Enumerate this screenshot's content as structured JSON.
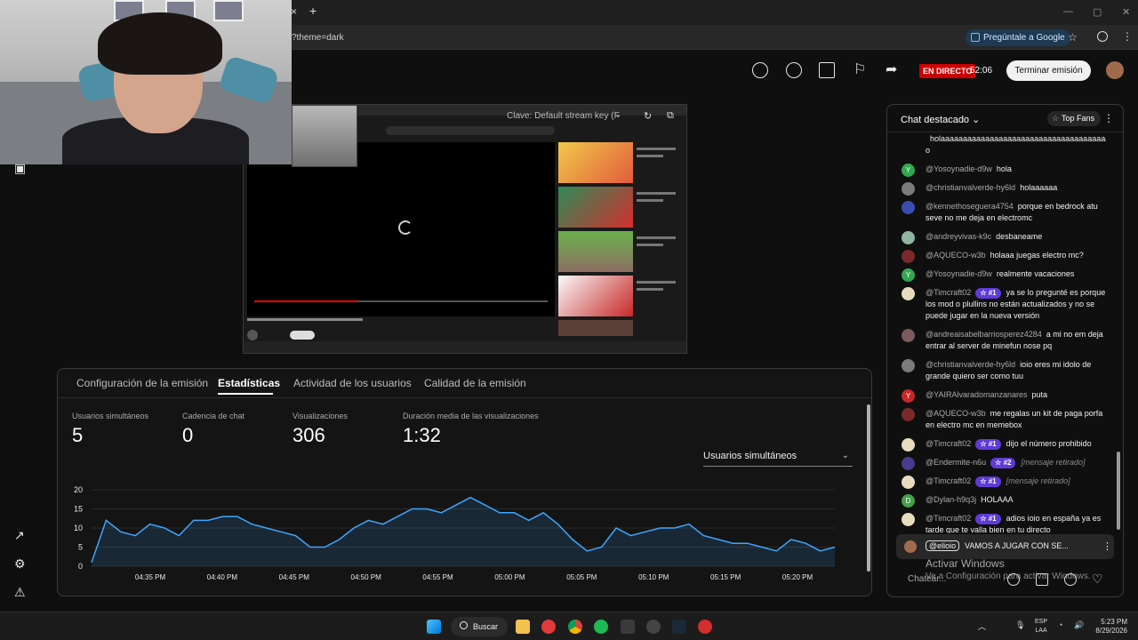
{
  "browser": {
    "url_fragment": "?theme=dark",
    "ask_google": "Pregúntale a Google"
  },
  "header": {
    "live_badge": "EN DIRECTO",
    "live_time": "52:06",
    "end_button": "Terminar emisión"
  },
  "preview": {
    "stream_key": "Clave: Default stream key (F"
  },
  "stats": {
    "tabs": [
      "Configuración de la emisión",
      "Estadísticas",
      "Actividad de los usuarios",
      "Calidad de la emisión"
    ],
    "active_tab": "Estadísticas",
    "metrics": [
      {
        "label": "Usuarios simultáneos",
        "value": "5"
      },
      {
        "label": "Cadencia de chat",
        "value": "0"
      },
      {
        "label": "Visualizaciones",
        "value": "306"
      },
      {
        "label": "Duración media de las visualizaciones",
        "value": "1:32"
      }
    ],
    "dropdown": "Usuarios simultáneos"
  },
  "chart_data": {
    "type": "area",
    "x_ticks": [
      "04:35 PM",
      "04:40 PM",
      "04:45 PM",
      "04:50 PM",
      "04:55 PM",
      "05:00 PM",
      "05:05 PM",
      "05:10 PM",
      "05:15 PM",
      "05:20 PM"
    ],
    "y_ticks": [
      0,
      5,
      10,
      15,
      20
    ],
    "ylim": [
      0,
      20
    ],
    "values": [
      1,
      12,
      9,
      8,
      11,
      10,
      8,
      12,
      12,
      13,
      13,
      11,
      10,
      9,
      8,
      5,
      5,
      7,
      10,
      12,
      11,
      13,
      15,
      15,
      14,
      16,
      18,
      16,
      14,
      14,
      12,
      14,
      11,
      7,
      4,
      5,
      10,
      8,
      9,
      10,
      10,
      11,
      8,
      7,
      6,
      6,
      5,
      4,
      7,
      6,
      4,
      5
    ],
    "color": "#3ea6ff"
  },
  "chat": {
    "title": "Chat destacado",
    "top_fans": "Top Fans",
    "messages": [
      {
        "author": "",
        "text": "holaaaaaaaaaaaaaaaaaaaaaaaaaaaaaaaaaaaaaaaaaaaaaa o",
        "badge": "",
        "avatar": "",
        "color": "#0f0f0f"
      },
      {
        "author": "@Yosoynadie-d9w",
        "text": "hola",
        "badge": "",
        "avatar": "Y",
        "color": "#33a852"
      },
      {
        "author": "@christianvalverde-hy6ld",
        "text": "holaaaaaa",
        "badge": "",
        "avatar": "",
        "color": "#7b7b7b"
      },
      {
        "author": "@kennethoseguera4754",
        "text": "porque en bedrock atu seve no me deja en electromc",
        "badge": "",
        "avatar": "",
        "color": "#3b4db0"
      },
      {
        "author": "@andreyvivas-k9c",
        "text": "desbaneame",
        "badge": "",
        "avatar": "",
        "color": "#8fb5a0"
      },
      {
        "author": "@AQUECO-w3b",
        "text": "holaaa juegas electro mc?",
        "badge": "",
        "avatar": "",
        "color": "#7a2a2a"
      },
      {
        "author": "@Yosoynadie-d9w",
        "text": "realmente vacaciones",
        "badge": "",
        "avatar": "Y",
        "color": "#33a852"
      },
      {
        "author": "@Timcraft02",
        "text": "ya se lo pregunté es porque los mod o plullins no están actualizados y no se puede jugar en la nueva versión",
        "badge": "#1",
        "avatar": "",
        "color": "#e8dcc0"
      },
      {
        "author": "@andreaisabelbarriosperez4284",
        "text": "a mi no em deja entrar al server de minefun nose pq",
        "badge": "",
        "avatar": "",
        "color": "#7a5a5a"
      },
      {
        "author": "@christianvalverde-hy6ld",
        "text": "ioio eres mi idolo de grande quiero ser como tuu",
        "badge": "",
        "avatar": "",
        "color": "#7b7b7b"
      },
      {
        "author": "@YAIRAlvaradomanzanares",
        "text": "puta",
        "badge": "",
        "avatar": "Y",
        "color": "#c62828"
      },
      {
        "author": "@AQUECO-w3b",
        "text": "me regalas un kit de paga porfa en electro mc en memebox",
        "badge": "",
        "avatar": "",
        "color": "#7a2a2a"
      },
      {
        "author": "@Timcraft02",
        "text": "dijo el número prohibido",
        "badge": "#1",
        "avatar": "",
        "color": "#e8dcc0"
      },
      {
        "author": "@Endermite-n6u",
        "text": "[mensaje retirado]",
        "badge": "#2",
        "avatar": "",
        "color": "#4a3a8a",
        "retired": true
      },
      {
        "author": "@Timcraft02",
        "text": "[mensaje retirado]",
        "badge": "#1",
        "avatar": "",
        "color": "#e8dcc0",
        "retired": true
      },
      {
        "author": "@Dylan-h9q3j",
        "text": "HOLAAA",
        "badge": "",
        "avatar": "D",
        "color": "#43a047"
      },
      {
        "author": "@Timcraft02",
        "text": "adios ioio en españa ya es tarde que te valla bien en tu directo",
        "badge": "#1",
        "avatar": "",
        "color": "#e8dcc0"
      }
    ],
    "pinned_tag": "@elioio",
    "pinned_text": "VAMOS A JUGAR CON SE...",
    "input_placeholder": "Chatear..."
  },
  "windows": {
    "activate_title": "Activar Windows",
    "activate_sub": "Ve a Configuración para activar Windows."
  },
  "taskbar": {
    "search": "Buscar",
    "lang": "ESP",
    "lang2": "LAA",
    "time": "5:23 PM",
    "date": "8/29/2026"
  }
}
